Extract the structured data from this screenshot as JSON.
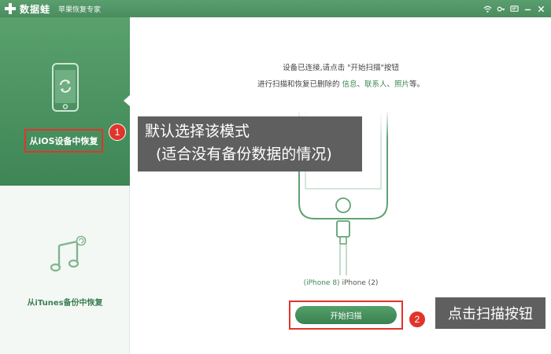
{
  "titlebar": {
    "app_name": "数据蛙",
    "subtitle": "苹果恢复专家",
    "controls": [
      "wifi-icon",
      "key-icon",
      "feedback-icon",
      "minimize-icon",
      "close-icon"
    ]
  },
  "sidebar": {
    "modes": [
      {
        "label": "从iOS设备中恢复",
        "selected": true,
        "icon": "phone-sync-icon"
      },
      {
        "label": "从iTunes备份中恢复",
        "selected": false,
        "icon": "music-restore-icon"
      }
    ]
  },
  "main": {
    "instruction_line1": "设备已连接,请点击 \"开始扫描\"按钮",
    "instruction_line2_prefix": "进行扫描和恢复已删除的 ",
    "instruction_links": [
      "信息",
      "联系人",
      "照片"
    ],
    "instruction_sep": "、",
    "instruction_line2_suffix": "等。",
    "device_model": "(iPhone 8)",
    "device_name": "iPhone (2)",
    "start_button": "开始扫描"
  },
  "callouts": [
    {
      "number": "1",
      "lines": [
        "默认选择该模式",
        "(适合没有备份数据的情况)"
      ]
    },
    {
      "number": "2",
      "lines": [
        "点击扫描按钮"
      ]
    }
  ],
  "colors": {
    "brand_green": "#4a8c5f",
    "highlight_red": "#e0352b",
    "callout_gray": "#5f5f5f"
  }
}
